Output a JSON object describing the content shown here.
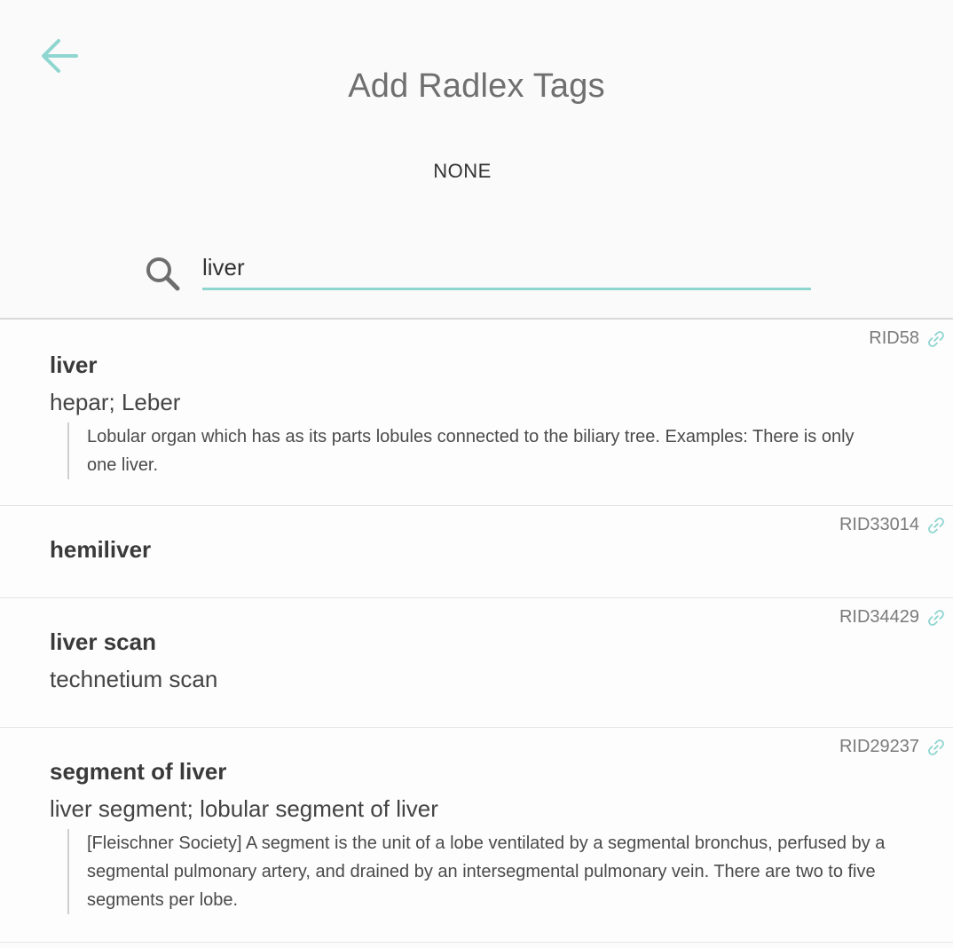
{
  "header": {
    "title": "Add Radlex Tags",
    "selected_tags": "NONE"
  },
  "search": {
    "value": "liver",
    "placeholder": ""
  },
  "results": [
    {
      "rid": "RID58",
      "term": "liver",
      "synonyms": "hepar; Leber",
      "definition": "Lobular organ which has as its parts lobules connected to the biliary tree. Examples: There is only one liver."
    },
    {
      "rid": "RID33014",
      "term": "hemiliver",
      "synonyms": "",
      "definition": ""
    },
    {
      "rid": "RID34429",
      "term": "liver scan",
      "synonyms": "technetium scan",
      "definition": ""
    },
    {
      "rid": "RID29237",
      "term": "segment of liver",
      "synonyms": "liver segment; lobular segment of liver",
      "definition": "[Fleischner Society] A segment is the unit of a lobe ventilated by a segmental bronchus, perfused by a segmental pulmonary artery, and drained by an intersegmental pulmonary vein. There are two to five segments per lobe."
    }
  ],
  "colors": {
    "accent": "#8fd5d0",
    "title_text": "#6f6f6f"
  },
  "icons": {
    "back": "arrow-left-icon",
    "search": "search-icon",
    "link": "link-icon"
  }
}
